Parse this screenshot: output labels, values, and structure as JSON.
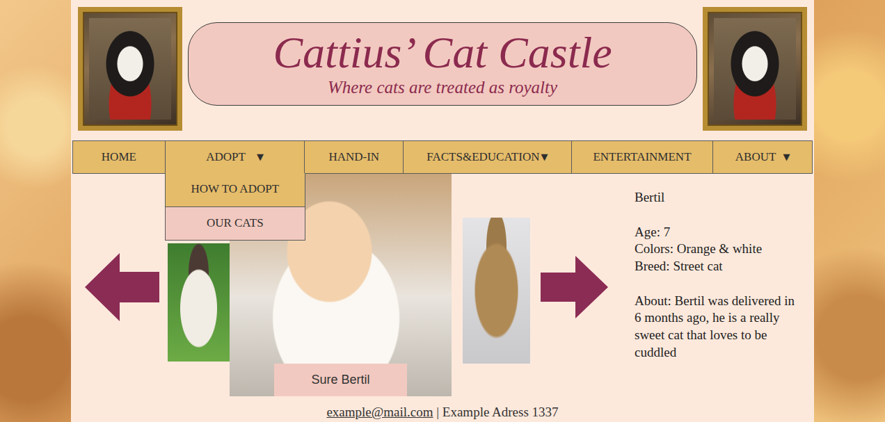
{
  "site": {
    "title": "Cattius’ Cat Castle",
    "tagline": "Where cats are treated as royalty"
  },
  "nav": [
    {
      "label": "HOME"
    },
    {
      "label": "ADOPT",
      "caret": "▼",
      "expanded": true,
      "menu": [
        {
          "label": "HOW TO ADOPT",
          "highlighted": true
        },
        {
          "label": "OUR CATS",
          "highlighted": false
        }
      ]
    },
    {
      "label": "HAND-IN"
    },
    {
      "label": "FACTS&EDUCATION",
      "caret": "▼",
      "expanded": false
    },
    {
      "label": "ENTERTAINMENT"
    },
    {
      "label": "ABOUT",
      "caret": "▼",
      "expanded": false
    }
  ],
  "carousel": {
    "caption": "Sure Bertil"
  },
  "cat": {
    "name": "Bertil",
    "fields": [
      {
        "label": "Age:",
        "value": "7"
      },
      {
        "label": "Colors:",
        "value": "Orange & white"
      },
      {
        "label": "Breed:",
        "value": "Street cat"
      }
    ],
    "about": "About: Bertil was delivered in 6 months ago, he is a really sweet cat that loves to be cuddled"
  },
  "footer": {
    "email": "example@mail.com",
    "separator": "|",
    "address": "Example Adress 1337"
  }
}
